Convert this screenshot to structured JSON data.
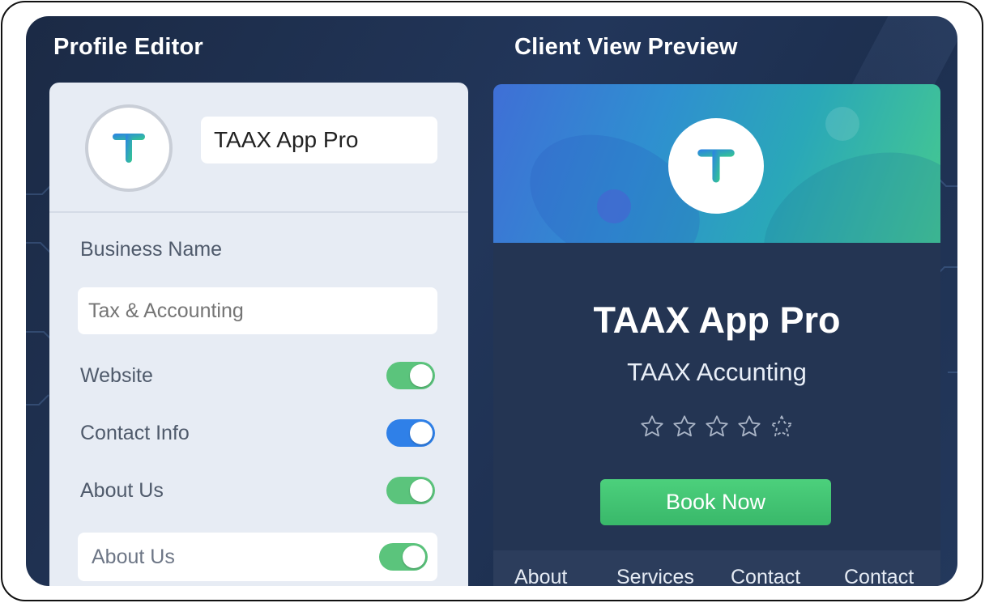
{
  "editor": {
    "title": "Profile Editor",
    "app_name_value": "TAAX App Pro",
    "business_name_label": "Business Name",
    "business_name_placeholder": "Tax & Accounting",
    "toggles": [
      {
        "label": "Website",
        "on": true,
        "color": "#5bc47c"
      },
      {
        "label": "Contact Info",
        "on": true,
        "color": "#2f80e8"
      },
      {
        "label": "About Us",
        "on": true,
        "color": "#5bc47c"
      }
    ],
    "about_box": {
      "label": "About Us",
      "on": true,
      "color": "#5bc47c"
    }
  },
  "preview": {
    "title": "Client View Preview",
    "business_name": "TAAX App Pro",
    "subtitle": "TAAX Accunting",
    "rating": {
      "value": 0,
      "max": 5
    },
    "book_button_label": "Book Now",
    "tabs": [
      {
        "label": "About",
        "active": true
      },
      {
        "label": "Services",
        "active": false
      },
      {
        "label": "Contact",
        "active": false
      },
      {
        "label": "Contact",
        "active": false
      }
    ]
  },
  "colors": {
    "accent_green": "#3fc476",
    "accent_blue": "#2f80e8",
    "logo_gradient": [
      "#2a7fe8",
      "#35c98e"
    ],
    "background": "#1d2f4f"
  },
  "icons": [
    "taax-logo-icon",
    "star-outline-icon"
  ]
}
